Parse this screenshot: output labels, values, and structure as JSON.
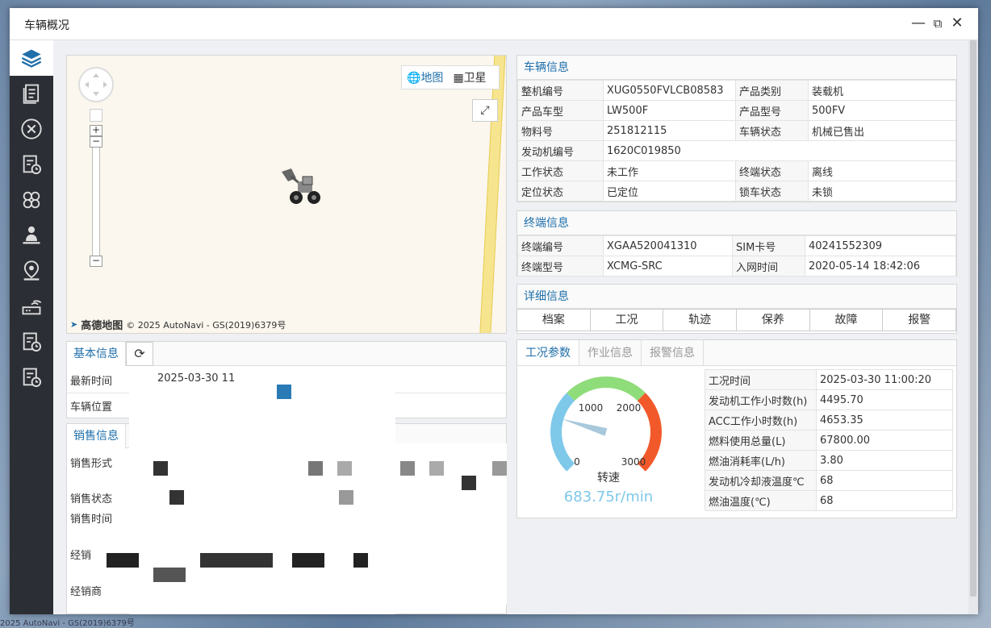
{
  "window": {
    "title": "车辆概况"
  },
  "background": {
    "credit": "2025 AutoNavi - GS(2019)6379号"
  },
  "sidebar": {
    "items": [
      {
        "icon": "layers-icon",
        "active": true
      },
      {
        "icon": "document-icon"
      },
      {
        "icon": "tools-icon"
      },
      {
        "icon": "report-clock-icon"
      },
      {
        "icon": "apps-icon"
      },
      {
        "icon": "person-icon"
      },
      {
        "icon": "location-pin-icon"
      },
      {
        "icon": "router-icon"
      },
      {
        "icon": "report-clock-icon"
      },
      {
        "icon": "report-clock-icon"
      }
    ]
  },
  "map": {
    "switch_map": "地图",
    "switch_satellite": "卫星",
    "brand": "高德地图",
    "credit": "© 2025 AutoNavi - GS(2019)6379号",
    "zoom_in": "+",
    "zoom_out": "−"
  },
  "vehicle_info": {
    "title": "车辆信息",
    "rows": [
      {
        "k1": "整机编号",
        "v1": "XUG0550FVLCB08583",
        "k2": "产品类别",
        "v2": "装载机"
      },
      {
        "k1": "产品车型",
        "v1": "LW500F",
        "k2": "产品型号",
        "v2": "500FV"
      },
      {
        "k1": "物料号",
        "v1": "251812115",
        "k2": "车辆状态",
        "v2": "机械已售出"
      },
      {
        "k1": "发动机编号",
        "v1": "1620C019850",
        "k2": "",
        "v2": ""
      },
      {
        "k1": "工作状态",
        "v1": "未工作",
        "k2": "终端状态",
        "v2": "离线"
      },
      {
        "k1": "定位状态",
        "v1": "已定位",
        "k2": "锁车状态",
        "v2": "未锁"
      }
    ]
  },
  "terminal_info": {
    "title": "终端信息",
    "rows": [
      {
        "k1": "终端编号",
        "v1": "XGAA520041310",
        "k2": "SIM卡号",
        "v2": "40241552309"
      },
      {
        "k1": "终端型号",
        "v1": "XCMG-SRC",
        "k2": "入网时间",
        "v2": "2020-05-14 18:42:06"
      }
    ]
  },
  "detail_info": {
    "title": "详细信息",
    "tabs": [
      "档案",
      "工况",
      "轨迹",
      "保养",
      "故障",
      "报警"
    ]
  },
  "work_condition": {
    "tabs": [
      "工况参数",
      "作业信息",
      "报警信息"
    ],
    "gauge": {
      "label": "转速",
      "value_text": "683.75r/min",
      "value": 683.75,
      "max": 3000,
      "ticks": [
        "0",
        "1000",
        "2000",
        "3000"
      ],
      "colors": {
        "low": "#7ec8ea",
        "mid": "#8fdc7a",
        "high": "#f2592a",
        "needle": "#a8c8dc",
        "value": "#7ec8ea"
      }
    },
    "rows": [
      {
        "k": "工况时间",
        "v": "2025-03-30 11:00:20"
      },
      {
        "k": "发动机工作小时数(h)",
        "v": "4495.70"
      },
      {
        "k": "ACC工作小时数(h)",
        "v": "4653.35"
      },
      {
        "k": "燃料使用总量(L)",
        "v": "67800.00"
      },
      {
        "k": "燃油消耗率(L/h)",
        "v": "3.80"
      },
      {
        "k": "发动机冷却液温度℃",
        "v": "68"
      },
      {
        "k": "燃油温度(℃)",
        "v": "68"
      }
    ]
  },
  "basic_info": {
    "title": "基本信息",
    "latest_time_label": "最新时间",
    "latest_time_value": "2025-03-30 11",
    "position_label": "车辆位置"
  },
  "sales_info": {
    "title": "销售信息",
    "labels": [
      "销售形式",
      "销售状态",
      "销售时间",
      "经销",
      "经销商"
    ]
  },
  "colors": {
    "accent": "#1f6faa",
    "sidebar": "#2b2e34"
  }
}
